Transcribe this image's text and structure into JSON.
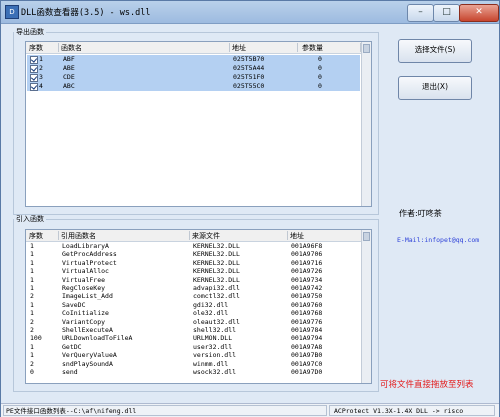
{
  "window": {
    "title": "DLL函数查看器(3.5) - ws.dll",
    "minimize_glyph": "–",
    "maximize_glyph": "□",
    "close_glyph": "✕"
  },
  "exports": {
    "group_label": "导出函数",
    "columns": [
      "序数",
      "函数名",
      "地址",
      "参数量"
    ],
    "rows": [
      {
        "ordinal": "1",
        "name": "ABF",
        "address": "025T5B70",
        "params": "0",
        "checked": true
      },
      {
        "ordinal": "2",
        "name": "ABE",
        "address": "025T5A44",
        "params": "0",
        "checked": true
      },
      {
        "ordinal": "3",
        "name": "CDE",
        "address": "025T51F0",
        "params": "0",
        "checked": true
      },
      {
        "ordinal": "4",
        "name": "ABC",
        "address": "025T55C0",
        "params": "0",
        "checked": true
      }
    ]
  },
  "imports": {
    "group_label": "引入函数",
    "columns": [
      "序数",
      "引用函数名",
      "来源文件",
      "地址"
    ],
    "rows": [
      {
        "ordinal": "1",
        "name": "LoadLibraryA",
        "source": "KERNEL32.DLL",
        "address": "001A96F8"
      },
      {
        "ordinal": "1",
        "name": "GetProcAddress",
        "source": "KERNEL32.DLL",
        "address": "001A9706"
      },
      {
        "ordinal": "1",
        "name": "VirtualProtect",
        "source": "KERNEL32.DLL",
        "address": "001A9716"
      },
      {
        "ordinal": "1",
        "name": "VirtualAlloc",
        "source": "KERNEL32.DLL",
        "address": "001A9726"
      },
      {
        "ordinal": "1",
        "name": "VirtualFree",
        "source": "KERNEL32.DLL",
        "address": "001A9734"
      },
      {
        "ordinal": "1",
        "name": "RegCloseKey",
        "source": "advapi32.dll",
        "address": "001A9742"
      },
      {
        "ordinal": "2",
        "name": "ImageList_Add",
        "source": "comctl32.dll",
        "address": "001A9750"
      },
      {
        "ordinal": "1",
        "name": "SaveDC",
        "source": "gdi32.dll",
        "address": "001A9760"
      },
      {
        "ordinal": "1",
        "name": "CoInitialize",
        "source": "ole32.dll",
        "address": "001A9768"
      },
      {
        "ordinal": "2",
        "name": "VariantCopy",
        "source": "oleaut32.dll",
        "address": "001A9776"
      },
      {
        "ordinal": "2",
        "name": "ShellExecuteA",
        "source": "shell32.dll",
        "address": "001A9784"
      },
      {
        "ordinal": "100",
        "name": "URLDownloadToFileA",
        "source": "URLMON.DLL",
        "address": "001A9794"
      },
      {
        "ordinal": "1",
        "name": "GetDC",
        "source": "user32.dll",
        "address": "001A97A8"
      },
      {
        "ordinal": "1",
        "name": "VerQueryValueA",
        "source": "version.dll",
        "address": "001A97B0"
      },
      {
        "ordinal": "2",
        "name": "sndPlaySoundA",
        "source": "winmm.dll",
        "address": "001A97C0"
      },
      {
        "ordinal": "0",
        "name": "send",
        "source": "wsock32.dll",
        "address": "001A97D0"
      }
    ]
  },
  "buttons": {
    "select_file": "选择文件(S)",
    "exit": "退出(X)"
  },
  "author": "作者:叮咚茶",
  "email": "E-Mail:infopet@qq.com",
  "drag_hint": "可将文件直接拖放至列表",
  "status": {
    "left": "PE文件接口函数列表--C:\\af\\nifeng.dll",
    "right": "ACProtect V1.3X-1.4X DLL -> risco"
  },
  "colors": {
    "selection": "#b4d0f2",
    "drag_hint": "#e31b1b",
    "email": "#2b3fd8"
  }
}
